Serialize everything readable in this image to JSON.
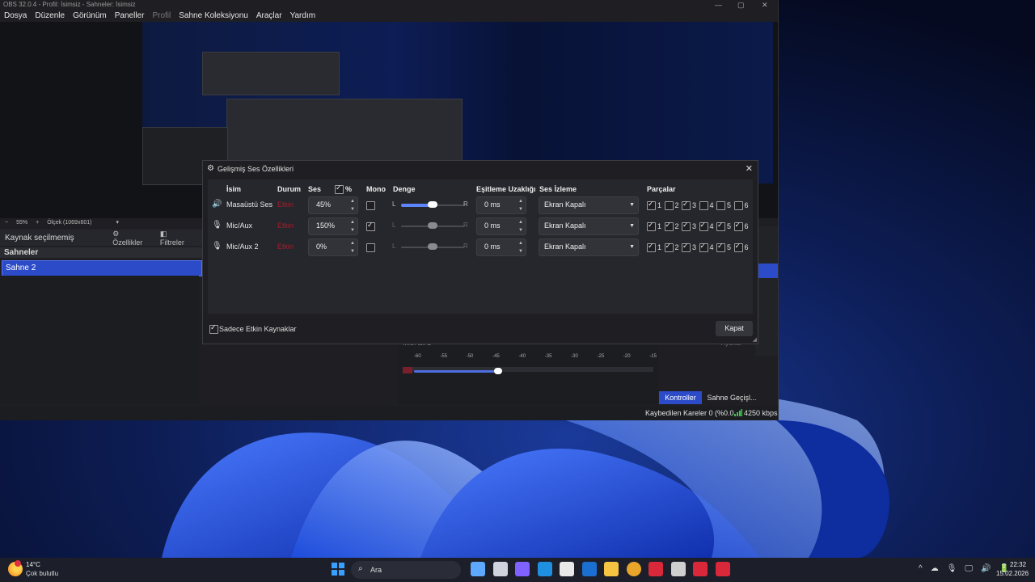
{
  "window": {
    "title": "OBS 32.0.4 - Profil: İsimsiz - Sahneler: İsimsiz",
    "controls": [
      "—",
      "▢",
      "✕"
    ]
  },
  "menu": [
    "Dosya",
    "Düzenle",
    "Görünüm",
    "Paneller",
    "Profil",
    "Sahne Koleksiyonu",
    "Araçlar",
    "Yardım"
  ],
  "preview_bar": {
    "zoom_minus": "−",
    "zoom_value": "55%",
    "zoom_plus": "+",
    "scale": "Ölçek (1069x601)",
    "arrow": "▾"
  },
  "source_bar": {
    "label": "Kaynak seçilmemiş",
    "properties": "⚙ Özellikler",
    "filters": "◧ Filtreler"
  },
  "scenes": {
    "title": "Sahneler",
    "items": [
      "Sahne 2"
    ]
  },
  "mixer": {
    "name": "Mic/Aux 2",
    "scale": [
      "-60",
      "-55",
      "-50",
      "-45",
      "-40",
      "-35",
      "-30",
      "-25",
      "-20",
      "-15"
    ],
    "volume_level": 0.34
  },
  "docks": {
    "settings": "Ayarlar",
    "controls": "Kontroller",
    "transitions": "Sahne Geçişl..."
  },
  "status": {
    "dropped": "Kaybedilen Kareler 0 (%0.0",
    "bitrate": "4250 kbps"
  },
  "dialog": {
    "title": "Gelişmiş Ses Özellikleri",
    "close_x": "✕",
    "headers": {
      "name": "İsim",
      "status": "Durum",
      "volume": "Ses",
      "percent": "%",
      "mono": "Mono",
      "balance": "Denge",
      "sync_offset": "Eşitleme Uzaklığı",
      "monitoring": "Ses İzleme",
      "tracks": "Parçalar"
    },
    "balance_left": "L",
    "balance_right": "R",
    "rows": [
      {
        "icon": "🔊",
        "name": "Masaüstü Ses",
        "status": "Etkin",
        "volume": "45%",
        "mono": false,
        "sync": "0 ms",
        "monitoring": "Ekran Kapalı",
        "tracks": [
          true,
          false,
          true,
          false,
          false,
          false
        ],
        "balance": 0.5
      },
      {
        "icon": "🎙",
        "name": "Mic/Aux",
        "status": "Etkin",
        "volume": "150%",
        "mono": true,
        "sync": "0 ms",
        "monitoring": "Ekran Kapalı",
        "tracks": [
          true,
          true,
          true,
          true,
          true,
          true
        ],
        "balance": 0.5
      },
      {
        "icon": "🎙",
        "name": "Mic/Aux 2",
        "status": "Etkin",
        "volume": "0%",
        "mono": false,
        "sync": "0 ms",
        "monitoring": "Ekran Kapalı",
        "tracks": [
          true,
          true,
          true,
          true,
          true,
          true
        ],
        "balance": 0.5
      }
    ],
    "track_labels": [
      "1",
      "2",
      "3",
      "4",
      "5",
      "6"
    ],
    "only_active_label": "Sadece Etkin Kaynaklar",
    "only_active_checked": true,
    "close_button": "Kapat"
  },
  "taskbar": {
    "weather_temp": "14°C",
    "weather_desc": "Çok bulutlu",
    "search_placeholder": "Ara",
    "tray_icons": [
      "^",
      "☁",
      "🎙",
      "🖵",
      "🔊",
      "🔋"
    ],
    "time": "22:32",
    "date": "15.02.2026",
    "apps": [
      {
        "name": "copilot",
        "color": "#5fa8ff"
      },
      {
        "name": "task-view",
        "color": "#cfd3db"
      },
      {
        "name": "widgets",
        "color": "#7f62ff"
      },
      {
        "name": "edge",
        "color": "#1f8fe0"
      },
      {
        "name": "store",
        "color": "#e8e8e8"
      },
      {
        "name": "outlook",
        "color": "#1a6fd1"
      },
      {
        "name": "file-explorer",
        "color": "#f5c443"
      },
      {
        "name": "chrome",
        "color": "#e9a52a"
      },
      {
        "name": "obs-red-1",
        "color": "#d9283a"
      },
      {
        "name": "obs-studio",
        "color": "#cfcfcf"
      },
      {
        "name": "obs-red-2",
        "color": "#d9283a"
      },
      {
        "name": "obs-red-3",
        "color": "#d9283a"
      }
    ]
  }
}
